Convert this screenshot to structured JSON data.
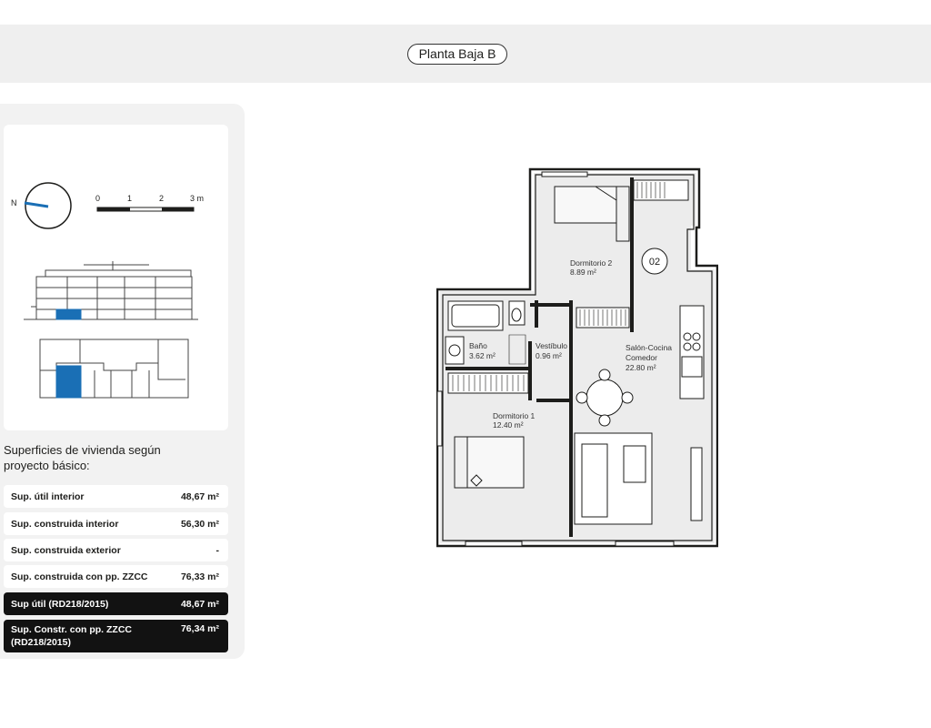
{
  "header": {
    "floor_label": "Planta Baja B"
  },
  "orientation": {
    "north_label": "N"
  },
  "scale_bar": {
    "ticks": [
      "0",
      "1",
      "2",
      "3 m"
    ]
  },
  "plan": {
    "unit_number": "02",
    "rooms": [
      {
        "name": "Dormitorio 2",
        "area": "8.89 m²"
      },
      {
        "name": "Baño",
        "area": "3.62 m²"
      },
      {
        "name": "Vestíbulo",
        "area": "0.96 m²"
      },
      {
        "name": "Salón-Cocina Comedor",
        "area": "22.80 m²"
      },
      {
        "name": "Dormitorio 1",
        "area": "12.40 m²"
      }
    ]
  },
  "surfaces": {
    "title": "Superficies de vivienda según proyecto básico:",
    "rows": [
      {
        "label": "Sup. útil interior",
        "value": "48,67 m²",
        "dark": false
      },
      {
        "label": "Sup. construida interior",
        "value": "56,30 m²",
        "dark": false
      },
      {
        "label": "Sup. construida exterior",
        "value": "-",
        "dark": false
      },
      {
        "label": "Sup. construida con pp. ZZCC",
        "value": "76,33 m²",
        "dark": false
      },
      {
        "label": "Sup útil (RD218/2015)",
        "value": "48,67 m²",
        "dark": true
      },
      {
        "label": "Sup. Constr. con pp. ZZCC (RD218/2015)",
        "value": "76,34 m²",
        "dark": true
      }
    ]
  },
  "colors": {
    "highlight": "#1a6fb5",
    "dark_row": "#121212",
    "panel": "#f2f2f2",
    "floor_fill": "#ececec"
  }
}
